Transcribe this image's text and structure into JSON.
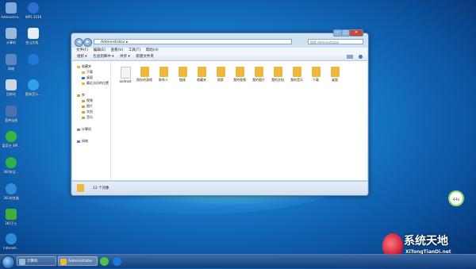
{
  "desktop": {
    "icons": [
      {
        "label": "Administra...",
        "color": "#7fa9d8"
      },
      {
        "label": "WPS 2019",
        "color": "#2f6fd0"
      },
      {
        "label": "计算机",
        "color": "#9ab8d8"
      },
      {
        "label": "金山文档...",
        "color": "#e8eef6"
      },
      {
        "label": "网络",
        "color": "#5a86c2"
      },
      {
        "label": "",
        "color": "#1e78d6"
      },
      {
        "label": "回收站",
        "color": "#c8d6e6"
      },
      {
        "label": "酷狗音乐...",
        "color": "#2ea0ea"
      },
      {
        "label": "宽带连接",
        "color": "#4a70b0"
      },
      {
        "label": "爱奇艺 WP...",
        "color": "#37b53c"
      },
      {
        "label": "360安全...",
        "color": "#2ab14a"
      },
      {
        "label": "360浏览器",
        "color": "#2f8dd8"
      },
      {
        "label": "360卫士",
        "color": "#3cae3c"
      },
      {
        "label": "Internet...",
        "color": "#2c8bd8"
      }
    ]
  },
  "window": {
    "nav_back": "◀",
    "nav_forward": "▶",
    "address": "Administrator ▸",
    "search_placeholder": "搜索 Administrator",
    "controls": {
      "minimize": "–",
      "maximize": "□",
      "close": "✕"
    },
    "menu": [
      "文件(F)",
      "编辑(E)",
      "查看(V)",
      "工具(T)",
      "帮助(H)"
    ],
    "toolbar": [
      "组织 ▾",
      "包含到库中 ▾",
      "共享 ▾",
      "新建文件夹"
    ],
    "sidebar": {
      "favorites": {
        "title": "收藏夹",
        "items": [
          "下载",
          "桌面",
          "最近访问的位置"
        ]
      },
      "libraries": {
        "title": "库",
        "items": [
          "视频",
          "图片",
          "文档",
          "音乐"
        ]
      },
      "computer": "计算机",
      "network": "网络"
    },
    "folders": [
      "android",
      "保存的游戏",
      "联系人",
      "链接",
      "收藏夹",
      "搜索",
      "我的视频",
      "我的图片",
      "我的文档",
      "我的音乐",
      "下载",
      "桌面"
    ],
    "status": "12 个对象"
  },
  "taskbar": {
    "tasks": [
      {
        "label": "计算机",
        "color": "#9ab8d8"
      },
      {
        "label": "Administrator",
        "color": "#e9b83c"
      }
    ]
  },
  "gadget": {
    "text": "44s"
  },
  "watermark": {
    "title": "系统天地",
    "subtitle": "XiTongTianDi.net"
  }
}
